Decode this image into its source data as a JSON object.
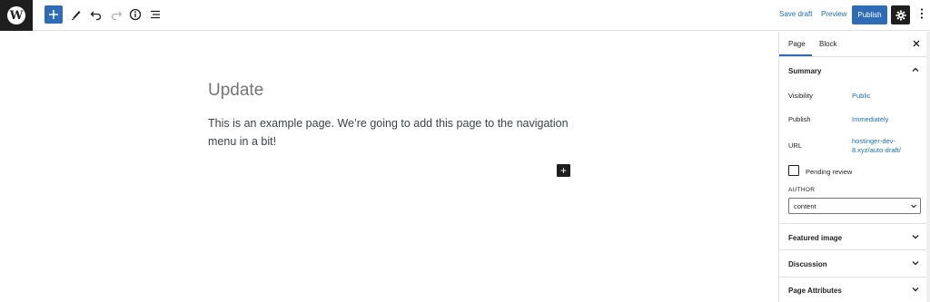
{
  "toolbar": {
    "save_draft": "Save draft",
    "preview": "Preview",
    "publish": "Publish",
    "icons": [
      "wordpress-logo-icon",
      "add-block-icon",
      "edit-pencil-icon",
      "undo-icon",
      "redo-icon",
      "info-icon",
      "list-view-icon",
      "settings-gear-icon",
      "more-options-icon"
    ]
  },
  "editor": {
    "title": "Update",
    "paragraph": "This is an example page.  We’re going to add this page to the navigation menu in a bit!",
    "add_block_glyph": "+"
  },
  "sidebar": {
    "tabs": [
      "Page",
      "Block"
    ],
    "active_tab": "Page",
    "summary": {
      "title": "Summary",
      "visibility_label": "Visibility",
      "visibility_value": "Public",
      "publish_label": "Publish",
      "publish_value": "Immediately",
      "url_label": "URL",
      "url_value": "hostinger-dev-8.xyz/auto-draft/",
      "pending_review": "Pending review",
      "author_label": "AUTHOR",
      "author_value": "content"
    },
    "panels": [
      "Featured image",
      "Discussion",
      "Page Attributes"
    ]
  },
  "colors": {
    "accent": "#2f6cb6",
    "link": "#2271b1",
    "dark": "#1e1e1e",
    "border": "#e0e0e0"
  }
}
